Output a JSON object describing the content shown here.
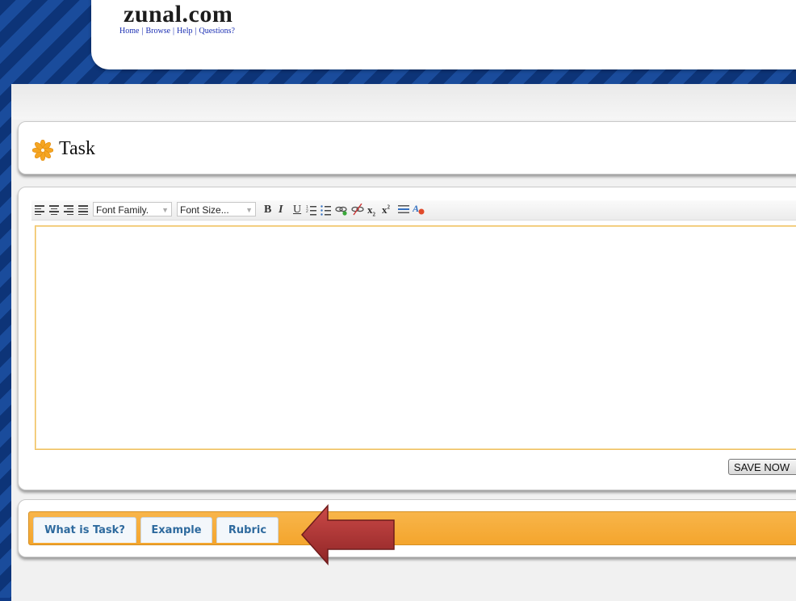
{
  "site": {
    "logo": "zunal.com",
    "links": [
      "Home",
      "Browse",
      "Help",
      "Questions?"
    ]
  },
  "task_panel": {
    "title": "Task",
    "icon": "asterisk-flower-icon",
    "icon_color": "#f5a623"
  },
  "toolbar": {
    "font_family_placeholder": "Font Family.",
    "font_size_placeholder": "Font Size...",
    "buttons": [
      "align-left",
      "align-center",
      "align-right",
      "align-justify",
      "bold",
      "italic",
      "underline",
      "ordered-list",
      "unordered-list",
      "link",
      "unlink",
      "subscript",
      "superscript",
      "horizontal-rule",
      "clean-format"
    ],
    "bold": "B",
    "italic": "I",
    "underline": "U",
    "subscript": "x",
    "superscript": "x"
  },
  "editor": {
    "content": ""
  },
  "save_button": "SAVE NOW",
  "tabs": [
    "What is Task?",
    "Example",
    "Rubric"
  ],
  "colors": {
    "background": "#0f3a86",
    "tab_bar": "#f4a52d",
    "tab_text": "#2e6a9e",
    "arrow": "#b8393b"
  }
}
